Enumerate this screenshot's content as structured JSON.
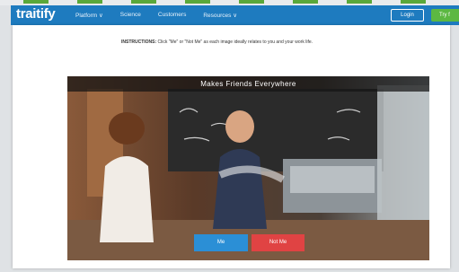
{
  "nav": {
    "logo": "traitify",
    "links": [
      "Platform ∨",
      "Science",
      "Customers",
      "Resources ∨"
    ],
    "login_label": "Login",
    "try_label": "Try f"
  },
  "instructions": {
    "prefix": "INSTRUCTIONS:",
    "text": " Click \"Me\" or \"Not Me\" as each image ideally relates to you and your work life."
  },
  "card": {
    "title": "Makes Friends Everywhere",
    "me_label": "Me",
    "not_me_label": "Not Me"
  },
  "colors": {
    "nav_bg": "#1e7bbf",
    "me": "#2b8fd6",
    "not_me": "#e04343",
    "try": "#5cb842"
  }
}
